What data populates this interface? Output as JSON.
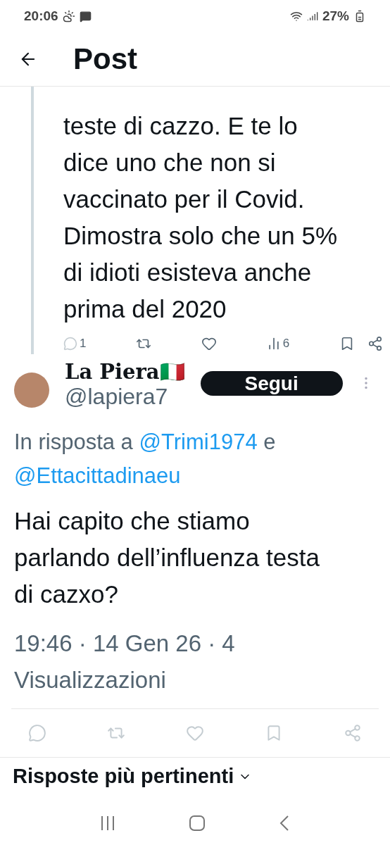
{
  "status_bar": {
    "time": "20:06",
    "battery": "27%"
  },
  "header": {
    "title": "Post"
  },
  "parent_post": {
    "lines": [
      "teste di cazzo. E te lo",
      "dice uno che non si",
      "vaccinato per il Covid.",
      "Dimostra solo che un 5%",
      "di idioti esisteva anche",
      "prima del 2020"
    ],
    "actions": {
      "replies": "1",
      "views": "6"
    }
  },
  "reply": {
    "name": "La Piera",
    "flag": "🇮🇹",
    "handle": "@lapiera7",
    "follow": "Segui",
    "in_reply_prefix": "In risposta a",
    "mentions": [
      "@Trimi1974",
      "@Ettacittadinaeu"
    ],
    "mention_joiner": "e",
    "text": "Hai capito che stiamo parlando dell’influenza testa di cazxo?",
    "meta": "19:46 · 14 Gen 26 · 4 Visualizzazioni"
  },
  "section": {
    "title": "Risposte più pertinenti"
  }
}
